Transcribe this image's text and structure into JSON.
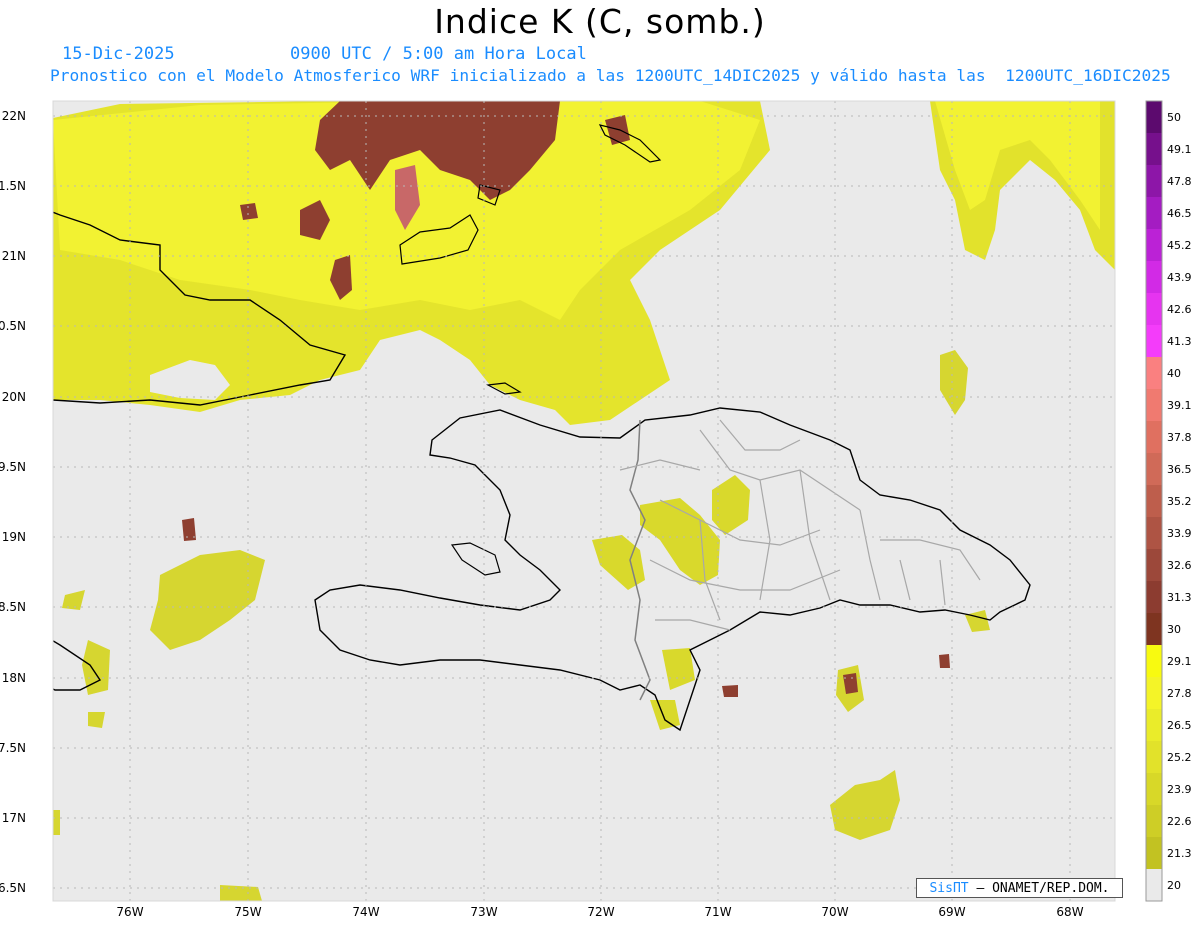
{
  "title": "Indice K (C, somb.)",
  "date_label": "15-Dic-2025",
  "time_label": "0900 UTC / 5:00 am Hora Local",
  "forecast_line": "Pronostico con el Modelo Atmosferico WRF inicializado a las 1200UTC_14DIC2025 y válido hasta las  1200UTC_16DIC2025",
  "credit": {
    "brand": "SisПT",
    "org": "– ONAMET/REP.DOM."
  },
  "lat_labels": [
    "22N",
    "1.5N",
    "21N",
    "0.5N",
    "20N",
    "9.5N",
    "19N",
    "8.5N",
    "18N",
    "7.5N",
    "17N",
    "6.5N"
  ],
  "lon_labels": [
    "76W",
    "75W",
    "74W",
    "73W",
    "72W",
    "71W",
    "70W",
    "69W",
    "68W"
  ],
  "colorbar": {
    "labels": [
      "50",
      "49.1",
      "47.8",
      "46.5",
      "45.2",
      "43.9",
      "42.6",
      "41.3",
      "40",
      "39.1",
      "37.8",
      "36.5",
      "35.2",
      "33.9",
      "32.6",
      "31.3",
      "30",
      "29.1",
      "27.8",
      "26.5",
      "25.2",
      "23.9",
      "22.6",
      "21.3",
      "20"
    ],
    "colors": [
      "#5c0a6e",
      "#76108c",
      "#8d16a8",
      "#a41cc2",
      "#bb22d6",
      "#d22ae6",
      "#e634f0",
      "#f43cfa",
      "#fa8080",
      "#f07a70",
      "#e07060",
      "#d06a58",
      "#be5e4c",
      "#ae5444",
      "#9c483a",
      "#8c3c30",
      "#7e3420",
      "#f8fa10",
      "#f4f428",
      "#eaec2a",
      "#e2e22a",
      "#d8d828",
      "#cece26",
      "#c2c222",
      "#eaeaea"
    ]
  },
  "colors": {
    "background_sea": "#eaeaea",
    "k_low": "#d6d630",
    "k_mid": "#eef230",
    "k_high": "#8e3f30",
    "coast": "#000000",
    "provinces": "#a0a0a0",
    "subtitle": "#1a8cff"
  }
}
